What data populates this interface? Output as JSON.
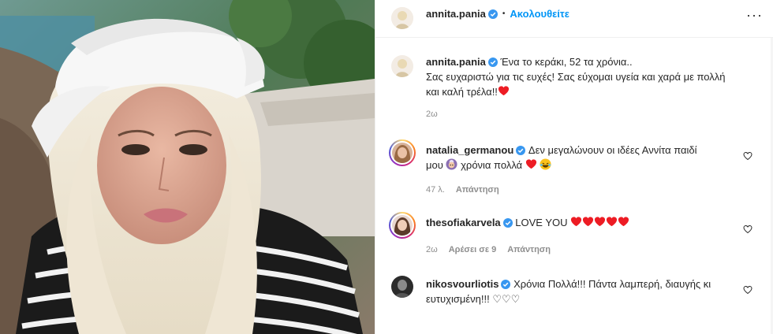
{
  "post": {
    "author": "annita.pania",
    "follow_label": "Ακολουθείτε",
    "dot": "•",
    "more": "···"
  },
  "caption": {
    "username": "annita.pania",
    "text_line1": "Ένα το κεράκι, 52 τα χρόνια..",
    "text_line2": "Σας ευχαριστώ για τις ευχές! Σας εύχομαι υγεία και χαρά με πολλή",
    "text_line3": "και καλή τρέλα!!",
    "time": "2ω"
  },
  "comments": [
    {
      "username": "natalia_germanou",
      "text_line1": "Δεν μεγαλώνουν οι ιδέες Αννίτα παιδί",
      "text_line2": "μου",
      "text_line2b": "χρόνια πολλά",
      "likes": "47 λ.",
      "reply": "Απάντηση"
    },
    {
      "username": "thesofiakarvela",
      "text_line1": "LOVE YOU",
      "time": "2ω",
      "likes": "Αρέσει σε 9",
      "reply": "Απάντηση"
    },
    {
      "username": "nikosvourliotis",
      "text_line1": "Χρόνια Πολλά!!! Πάντα λαμπερή, διαυγής κι",
      "text_line2": "ευτυχισμένη!!! ♡♡♡"
    }
  ],
  "colors": {
    "accent": "#0095f6",
    "verified": "#3897f0",
    "heart_red": "#ed1c24",
    "muted": "#8e8e8e"
  },
  "icons": [
    "verified-badge-icon",
    "more-options-icon",
    "heart-outline-icon",
    "red-heart-emoji",
    "laughing-emoji",
    "grandmother-emoji"
  ]
}
